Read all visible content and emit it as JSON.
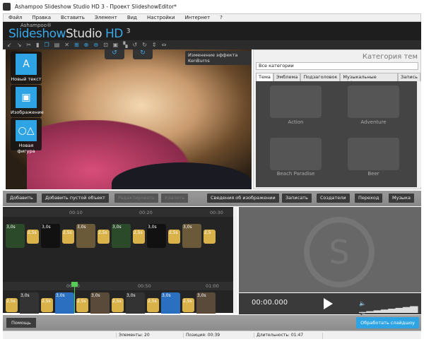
{
  "window": {
    "title": "Ashampoo Slideshow Studio HD 3 - Проект SlideshowEditor*"
  },
  "menu": [
    "Файл",
    "Правка",
    "Вставить",
    "Элемент",
    "Вид",
    "Настройки",
    "Интернет",
    "?"
  ],
  "logo": {
    "brand": "Ashampoo®",
    "name_a": "Slideshow",
    "name_b": "Studio",
    "name_c": " HD ",
    "version": "3"
  },
  "preview": {
    "kenburns_label": "Изменение эффекта KenBurns",
    "tools": [
      {
        "label": "Новый текст",
        "icon": "text-icon"
      },
      {
        "label": "Изображение",
        "icon": "image-icon"
      },
      {
        "label": "Новая фигура",
        "icon": "shapes-icon"
      }
    ]
  },
  "themes": {
    "title": "Категория тем",
    "select_value": "Все категории",
    "tabs": [
      "Тема",
      "Эмблема",
      "Подзаголовок",
      "Музыкальные эффекты",
      "Запись"
    ],
    "items": [
      "Action",
      "Adventure",
      "Beach Paradise",
      "Beer"
    ]
  },
  "buttons": {
    "add": "Добавить",
    "add_empty": "Добавить пустой объект",
    "edit": "Редактировать",
    "delete": "Удалить",
    "image_info": "Сведения об изображении",
    "record": "Записать",
    "credits": "Создатели",
    "transition": "Переход",
    "music": "Музыка"
  },
  "timeline1": {
    "ticks": [
      "00:10",
      "00:20",
      "00:30"
    ],
    "clips": [
      "3,0s",
      "2,5s",
      "3,0s",
      "2,5s",
      "3,0s",
      "2,5s",
      "3,0s",
      "2,5s",
      "3,0s",
      "2,5s",
      "3,0s",
      "2,5"
    ]
  },
  "timeline2": {
    "ticks": [
      "00:40",
      "00:50",
      "01:00"
    ],
    "clips": [
      "2,5s",
      "3,0s",
      "2,5s",
      "3,0s",
      "2,5s",
      "3,0s",
      "2,5s",
      "3,0s",
      "2,5s",
      "3,0s",
      "2,5s",
      "3,0s"
    ]
  },
  "player": {
    "time": "00:00.000",
    "volume": 0.9
  },
  "bottom": {
    "help": "Помощь",
    "render": "Обработать слайдшоу"
  },
  "status": {
    "elements": "Элементы: 20",
    "position": "Позиция: 00:39",
    "duration": "Длительность: 01:47"
  }
}
